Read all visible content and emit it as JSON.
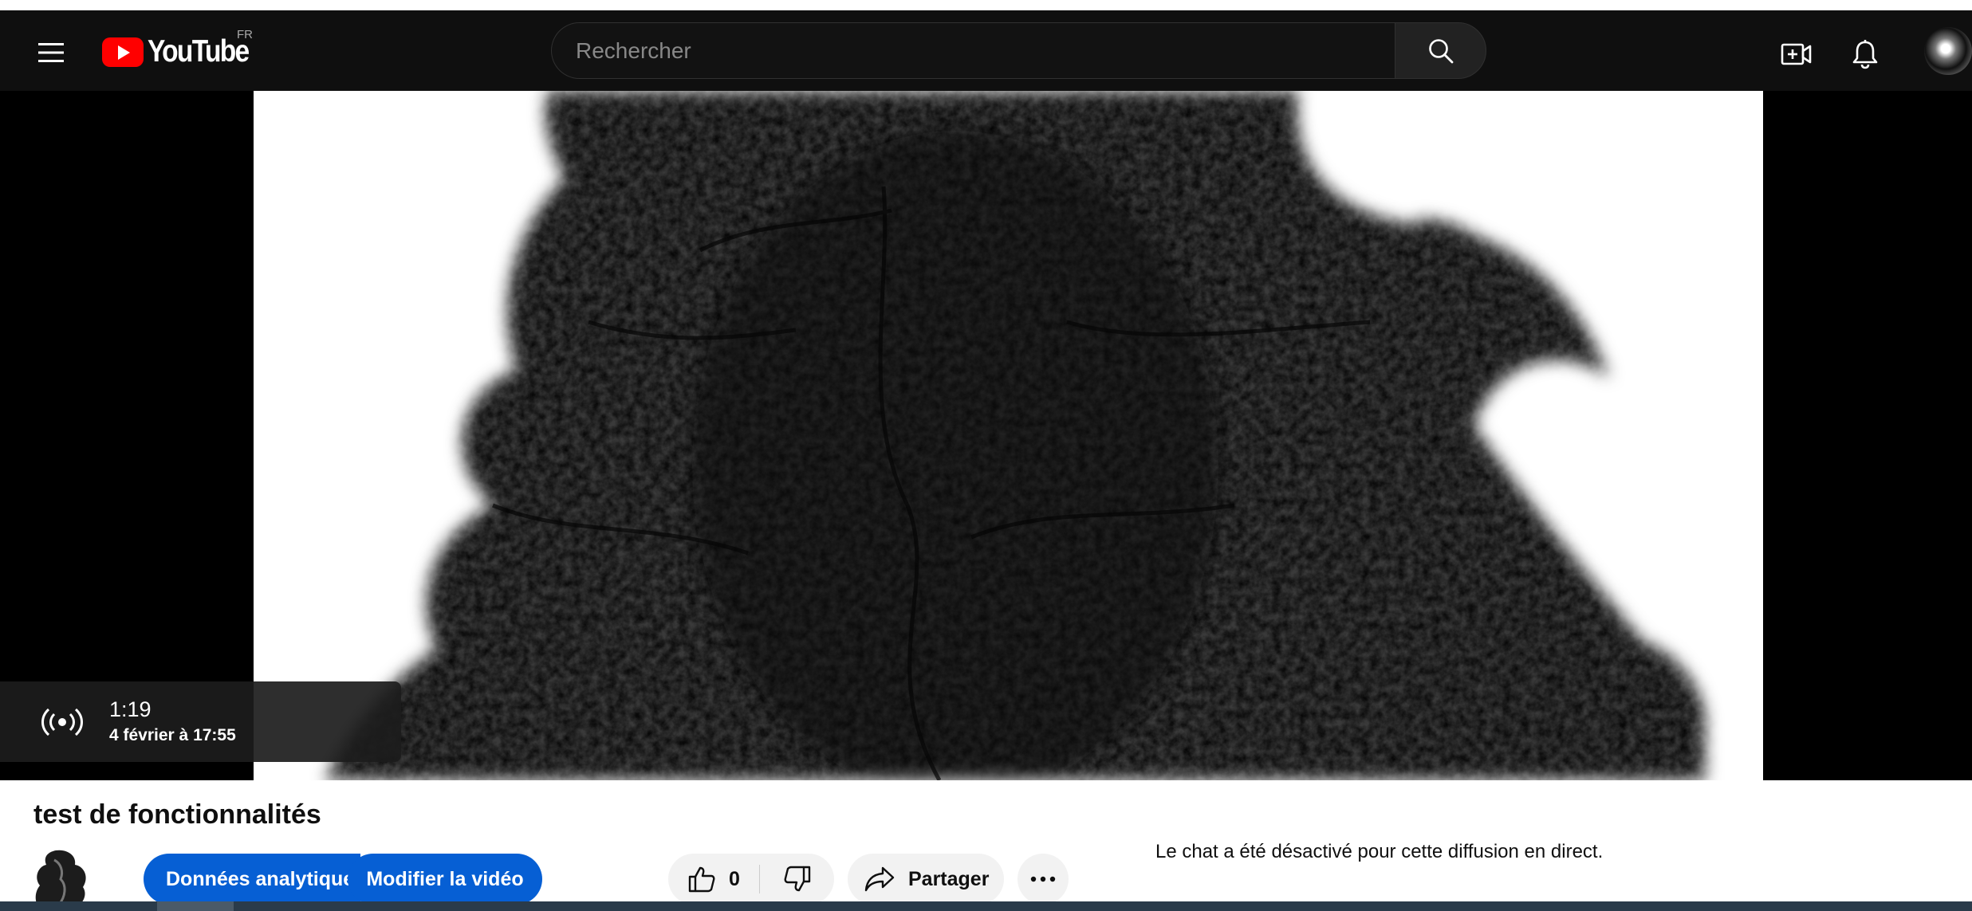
{
  "header": {
    "logo_text": "YouTube",
    "region_code": "FR",
    "search_placeholder": "Rechercher"
  },
  "player": {
    "live_elapsed": "1:19",
    "live_date": "4 février à 17:55"
  },
  "video": {
    "title": "test de fonctionnalités"
  },
  "actions": {
    "analytics_label": "Données analytiques",
    "edit_label": "Modifier la vidéo",
    "like_count": "0",
    "share_label": "Partager"
  },
  "chat": {
    "disabled_message": "Le chat a été désactivé pour cette diffusion en direct."
  },
  "icons": {
    "menu": "hamburger-icon",
    "search": "search-icon",
    "create": "create-video-icon",
    "notifications": "bell-icon",
    "live": "broadcast-icon",
    "like": "thumbs-up-icon",
    "dislike": "thumbs-down-icon",
    "share": "share-arrow-icon",
    "more": "more-horizontal-icon"
  },
  "colors": {
    "masthead_bg": "#0f0f0f",
    "brand_red": "#ff0000",
    "primary_button": "#065fd4",
    "chip_bg": "#f2f2f2"
  }
}
